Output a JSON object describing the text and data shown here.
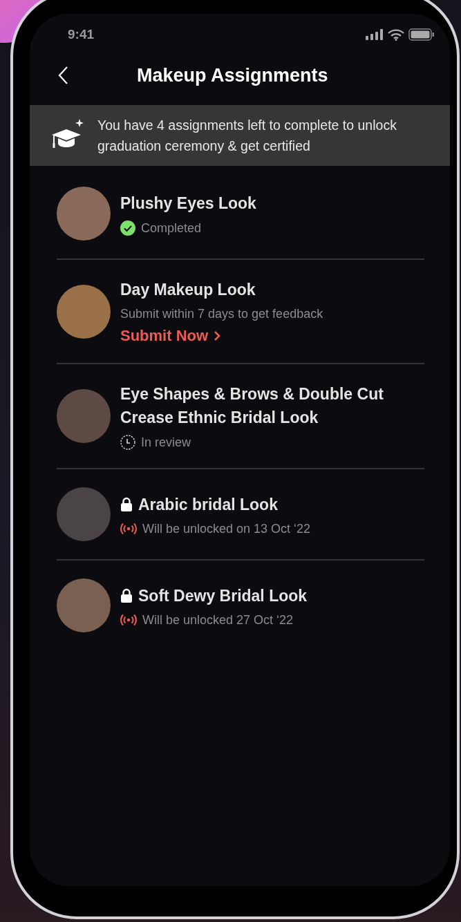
{
  "status_bar": {
    "time": "9:41"
  },
  "header": {
    "title": "Makeup Assignments"
  },
  "banner": {
    "text": "You have 4 assignments left to complete to unlock graduation ceremony & get certified"
  },
  "assignments": [
    {
      "title": "Plushy Eyes Look",
      "kind": "completed",
      "locked": false,
      "status": "Completed"
    },
    {
      "title": "Day Makeup Look",
      "kind": "pending",
      "locked": false,
      "status": "Submit within 7 days to get feedback",
      "action": "Submit Now"
    },
    {
      "title": "Eye Shapes & Brows & Double Cut Crease Ethnic Bridal Look",
      "kind": "review",
      "locked": false,
      "status": "In review"
    },
    {
      "title": "Arabic bridal Look",
      "kind": "scheduled",
      "locked": true,
      "status": "Will be unlocked on 13 Oct ‘22"
    },
    {
      "title": "Soft Dewy Bridal Look",
      "kind": "scheduled",
      "locked": true,
      "status": "Will be unlocked 27 Oct ‘22"
    }
  ]
}
